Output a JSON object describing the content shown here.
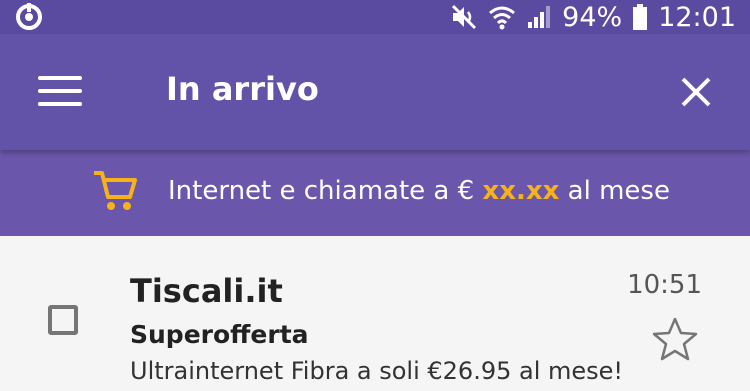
{
  "status_bar": {
    "battery": "94%",
    "time": "12:01",
    "icons": [
      "app-notification-icon",
      "mute-icon",
      "wifi-icon",
      "signal-icon",
      "battery-icon"
    ]
  },
  "toolbar": {
    "title": "In arrivo",
    "icons": [
      "menu-icon",
      "close-icon"
    ]
  },
  "banner": {
    "text_before": "Internet e chiamate a € ",
    "price": "xx.xx",
    "text_after": " al mese",
    "icon": "cart-icon"
  },
  "messages": [
    {
      "sender": "Tiscali.it",
      "subject": "Superofferta",
      "preview": "Ultrainternet Fibra a soli €26.95 al mese!",
      "time": "10:51",
      "starred": false
    }
  ],
  "colors": {
    "status_bar": "#5a4aa0",
    "toolbar": "#6252a8",
    "banner": "#6a57ab",
    "accent": "#f6b21b",
    "list_background": "#f5f5f5"
  }
}
